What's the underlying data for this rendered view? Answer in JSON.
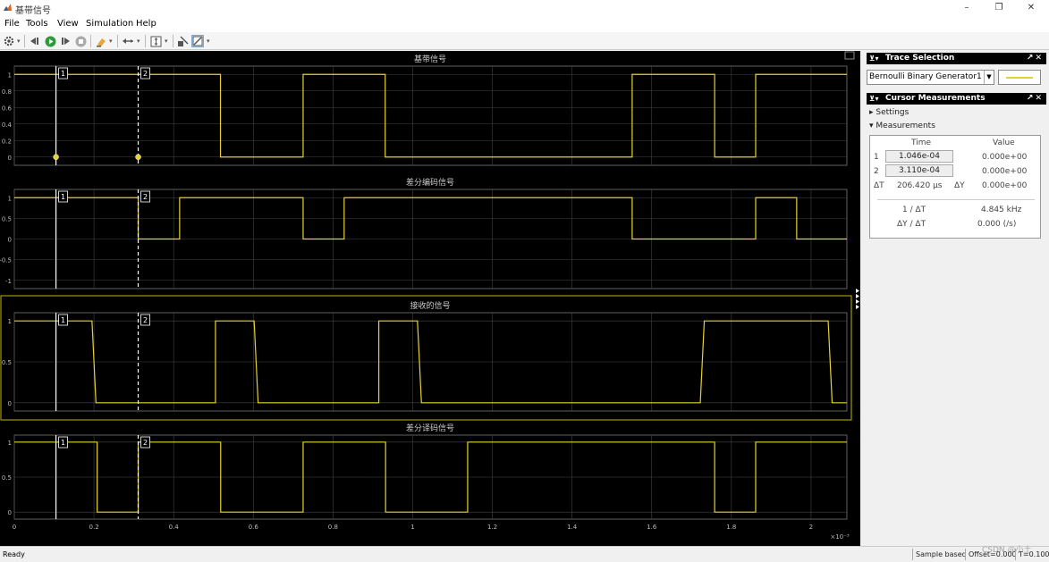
{
  "window": {
    "title": "基带信号",
    "minimize": "–",
    "restore": "❐",
    "close": "✕"
  },
  "menu": [
    "File",
    "Tools",
    "View",
    "Simulation",
    "Help"
  ],
  "toolbar_icons": [
    "gear-icon",
    "step-back-icon",
    "run-icon",
    "step-forward-icon",
    "stop-icon",
    "highlight-icon",
    "zoom-icon",
    "scale-axes-icon",
    "cursor-icon",
    "measure-icon"
  ],
  "colors": {
    "signal": "#e6d22f",
    "plot_bg": "#000000",
    "grid": "#444444",
    "axes_bg": "#000000",
    "highlight": "#c8b400"
  },
  "trace_selection": {
    "title": "Trace Selection",
    "selected": "Bernoulli Binary Generator1"
  },
  "cursor_measurements": {
    "title": "Cursor Measurements",
    "settings_label": "Settings",
    "measurements_label": "Measurements",
    "col_time": "Time",
    "col_value": "Value",
    "rows": [
      {
        "index": "1",
        "time": "1.046e-04",
        "value": "0.000e+00"
      },
      {
        "index": "2",
        "time": "3.110e-04",
        "value": "0.000e+00"
      }
    ],
    "delta_t_label": "ΔT",
    "delta_t": "206.420 µs",
    "delta_y_label": "ΔY",
    "delta_y": "0.000e+00",
    "inv_dt_label": "1 / ΔT",
    "inv_dt": "4.845 kHz",
    "dy_dt_label": "ΔY / ΔT",
    "dy_dt": "0.000 (/s)"
  },
  "status": {
    "ready": "Ready",
    "mode": "Sample based",
    "offset": "Offset=0.000",
    "time": "T=0.100"
  },
  "watermark": "CSDN @小土",
  "chart_data": {
    "type": "line",
    "x_label": "",
    "x_exponent": "×10⁻³",
    "xlim": [
      0,
      0.00209
    ],
    "x_ticks": [
      0,
      0.0002,
      0.0004,
      0.0006,
      0.0008,
      0.001,
      0.0012,
      0.0014,
      0.0016,
      0.0018,
      0.002
    ],
    "x_tick_labels": [
      "0",
      "0.2",
      "0.4",
      "0.6",
      "0.8",
      "1",
      "1.2",
      "1.4",
      "1.6",
      "1.8",
      "2"
    ],
    "cursors": [
      {
        "label": "1",
        "x": 0.0001046,
        "style": "solid"
      },
      {
        "label": "2",
        "x": 0.000311,
        "style": "dashed"
      }
    ],
    "plots": [
      {
        "title": "基带信号",
        "ylim": [
          -0.1,
          1.1
        ],
        "y_ticks": [
          0,
          0.2,
          0.4,
          0.6,
          0.8,
          1
        ],
        "y_tick_labels": [
          "0",
          "0.2",
          "0.4",
          "0.6",
          "0.8",
          "1"
        ],
        "x": [
          0,
          0.0005175,
          0.0005175,
          0.000725,
          0.000725,
          0.000931,
          0.000931,
          0.001551,
          0.001551,
          0.001758,
          0.001758,
          0.001861,
          0.001861,
          0.00209
        ],
        "y": [
          1,
          1,
          0,
          0,
          1,
          1,
          0,
          0,
          1,
          1,
          0,
          0,
          1,
          1
        ],
        "markers": [
          [
            0.0001046,
            0
          ],
          [
            0.000311,
            0
          ]
        ],
        "highlighted": false
      },
      {
        "title": "差分编码信号",
        "ylim": [
          -1.2,
          1.2
        ],
        "y_ticks": [
          -1,
          -0.5,
          0,
          0.5,
          1
        ],
        "y_tick_labels": [
          "-1",
          "-0.5",
          "0",
          "0.5",
          "1"
        ],
        "x": [
          0,
          0.000311,
          0.000311,
          0.000415,
          0.000415,
          0.000725,
          0.000725,
          0.000828,
          0.000828,
          0.001551,
          0.001551,
          0.001861,
          0.001861,
          0.001964,
          0.001964,
          0.00209
        ],
        "y": [
          1,
          1,
          0,
          0,
          1,
          1,
          0,
          0,
          1,
          1,
          0,
          0,
          1,
          1,
          0,
          0
        ],
        "markers": [],
        "highlighted": false
      },
      {
        "title": "接收的信号",
        "ylim": [
          -0.1,
          1.1
        ],
        "y_ticks": [
          0,
          0.5,
          1
        ],
        "y_tick_labels": [
          "0",
          "0.5",
          "1"
        ],
        "x": [
          0,
          0.000195,
          0.000205,
          0.000505,
          0.000505,
          0.000602,
          0.000612,
          0.000915,
          0.000915,
          0.001012,
          0.001022,
          0.001722,
          0.001732,
          0.002043,
          0.002053,
          0.00209
        ],
        "y": [
          1,
          1,
          0,
          0,
          1,
          1,
          0,
          0,
          1,
          1,
          0,
          0,
          1,
          1,
          0,
          0
        ],
        "markers": [],
        "highlighted": true
      },
      {
        "title": "差分译码信号",
        "ylim": [
          -0.1,
          1.1
        ],
        "y_ticks": [
          0,
          0.5,
          1
        ],
        "y_tick_labels": [
          "0",
          "0.5",
          "1"
        ],
        "x": [
          0,
          0.000208,
          0.000208,
          0.000311,
          0.000311,
          0.000518,
          0.000518,
          0.000725,
          0.000725,
          0.000932,
          0.000932,
          0.001138,
          0.001138,
          0.001758,
          0.001758,
          0.001861,
          0.001861,
          0.00209
        ],
        "y": [
          1,
          1,
          0,
          0,
          1,
          1,
          0,
          0,
          1,
          1,
          0,
          0,
          1,
          1,
          0,
          0,
          1,
          1
        ],
        "markers": [],
        "highlighted": false
      }
    ]
  }
}
